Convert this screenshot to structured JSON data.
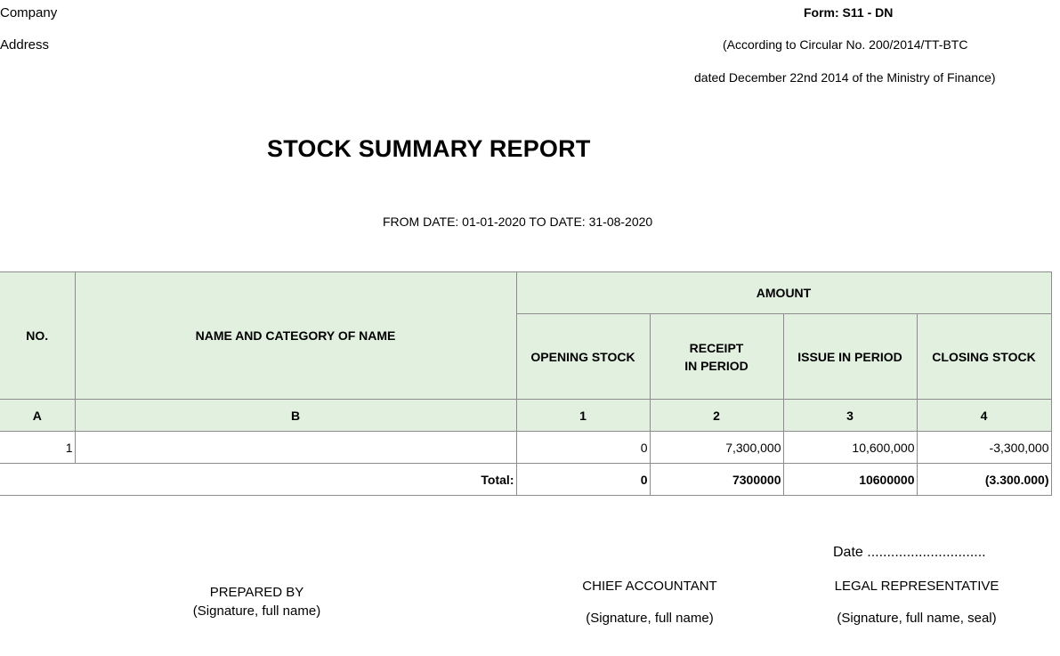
{
  "header": {
    "company_label": "Company",
    "address_label": "Address",
    "form_code": "Form: S11 - DN",
    "circular_line": "(According to Circular No. 200/2014/TT-BTC",
    "dated_line": "dated December 22nd 2014 of the Ministry of Finance)"
  },
  "report": {
    "title": "STOCK SUMMARY REPORT",
    "period": "FROM DATE: 01-01-2020 TO DATE: 31-08-2020"
  },
  "table": {
    "col_no": "NO.",
    "col_name": "NAME AND CATEGORY OF NAME",
    "amount_header": "AMOUNT",
    "amount_columns": [
      "OPENING STOCK",
      "RECEIPT",
      "IN PERIOD",
      "ISSUE IN PERIOD",
      "CLOSING STOCK"
    ],
    "codes": [
      "A",
      "B",
      "1",
      "2",
      "3",
      "4"
    ],
    "rows": [
      {
        "no": "1",
        "name": "",
        "opening": "0",
        "receipt": "7,300,000",
        "issue": "10,600,000",
        "closing": "-3,300,000"
      }
    ],
    "total": {
      "label": "Total:",
      "opening": "0",
      "receipt": "7300000",
      "issue": "10600000",
      "closing": "(3.300.000)"
    }
  },
  "signatures": {
    "date_line": "Date ..............................",
    "prepared_by": "PREPARED BY",
    "prepared_by_note": "(Signature, full name)",
    "chief_accountant": "CHIEF ACCOUNTANT",
    "chief_accountant_note": "(Signature, full name)",
    "legal_representative": "LEGAL REPRESENTATIVE",
    "legal_representative_note": "(Signature, full name, seal)"
  }
}
